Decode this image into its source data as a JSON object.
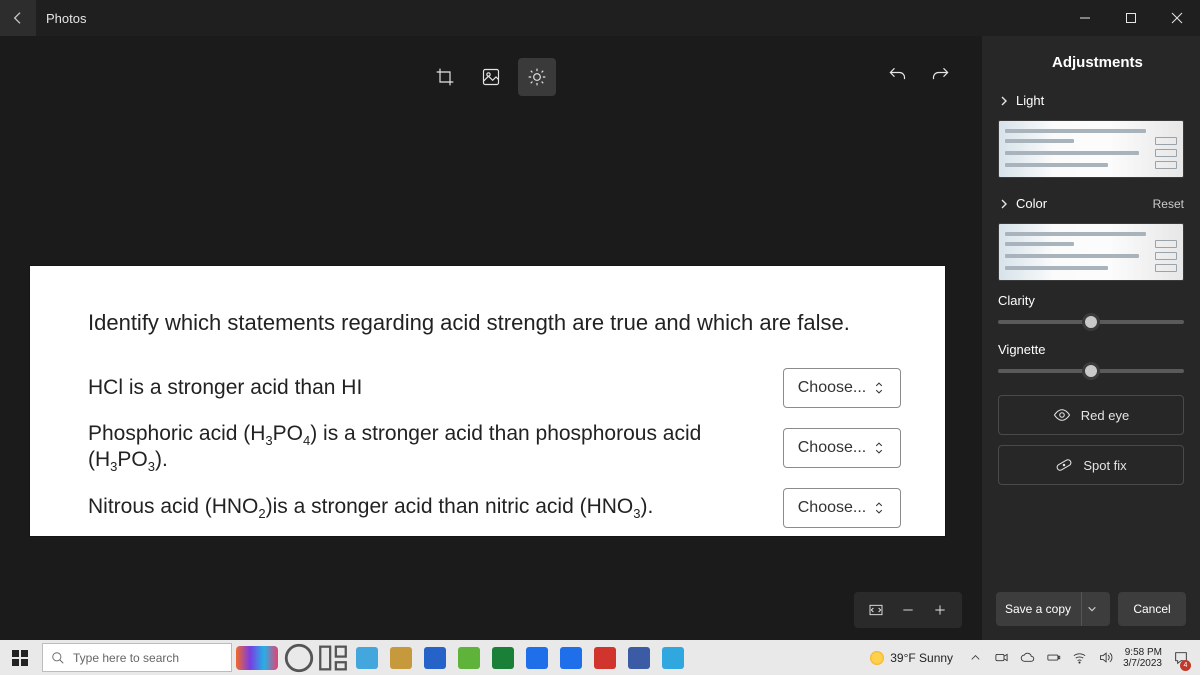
{
  "app": {
    "title": "Photos"
  },
  "toolbar": {
    "crop_icon": "crop-icon",
    "adjust_icon": "adjust-icon",
    "filter_icon": "filter-icon",
    "undo_icon": "undo-icon",
    "redo_icon": "redo-icon"
  },
  "image_content": {
    "question": "Identify which statements regarding acid strength are true and which are false.",
    "rows": [
      {
        "stmt": "HCl is a stronger acid than HI",
        "choose": "Choose..."
      },
      {
        "stmt_html": "Phosphoric acid (H<sub>3</sub>PO<sub>4</sub>) is a stronger acid than phosphorous acid (H<sub>3</sub>PO<sub>3</sub>).",
        "choose": "Choose..."
      },
      {
        "stmt_html": "Nitrous acid (HNO<sub>2</sub>)is a stronger acid than nitric acid (HNO<sub>3</sub>).",
        "choose": "Choose..."
      }
    ]
  },
  "side": {
    "title": "Adjustments",
    "light_label": "Light",
    "color_label": "Color",
    "reset_label": "Reset",
    "clarity_label": "Clarity",
    "vignette_label": "Vignette",
    "clarity_value": 50,
    "vignette_value": 50,
    "red_eye_label": "Red eye",
    "spot_fix_label": "Spot fix",
    "save_label": "Save a copy",
    "cancel_label": "Cancel"
  },
  "taskbar": {
    "search_placeholder": "Type here to search",
    "weather": "39°F Sunny",
    "time": "9:58 PM",
    "date": "3/7/2023",
    "notif_count": "4",
    "app_colors": [
      "#fff",
      "#fff",
      "#43a6dd",
      "#c69a3c",
      "#2563c9",
      "#5fb23a",
      "#1a7f37",
      "#1f6feb",
      "#1f6feb",
      "#d0342c",
      "#3b5ba5",
      "#30a7de"
    ]
  }
}
